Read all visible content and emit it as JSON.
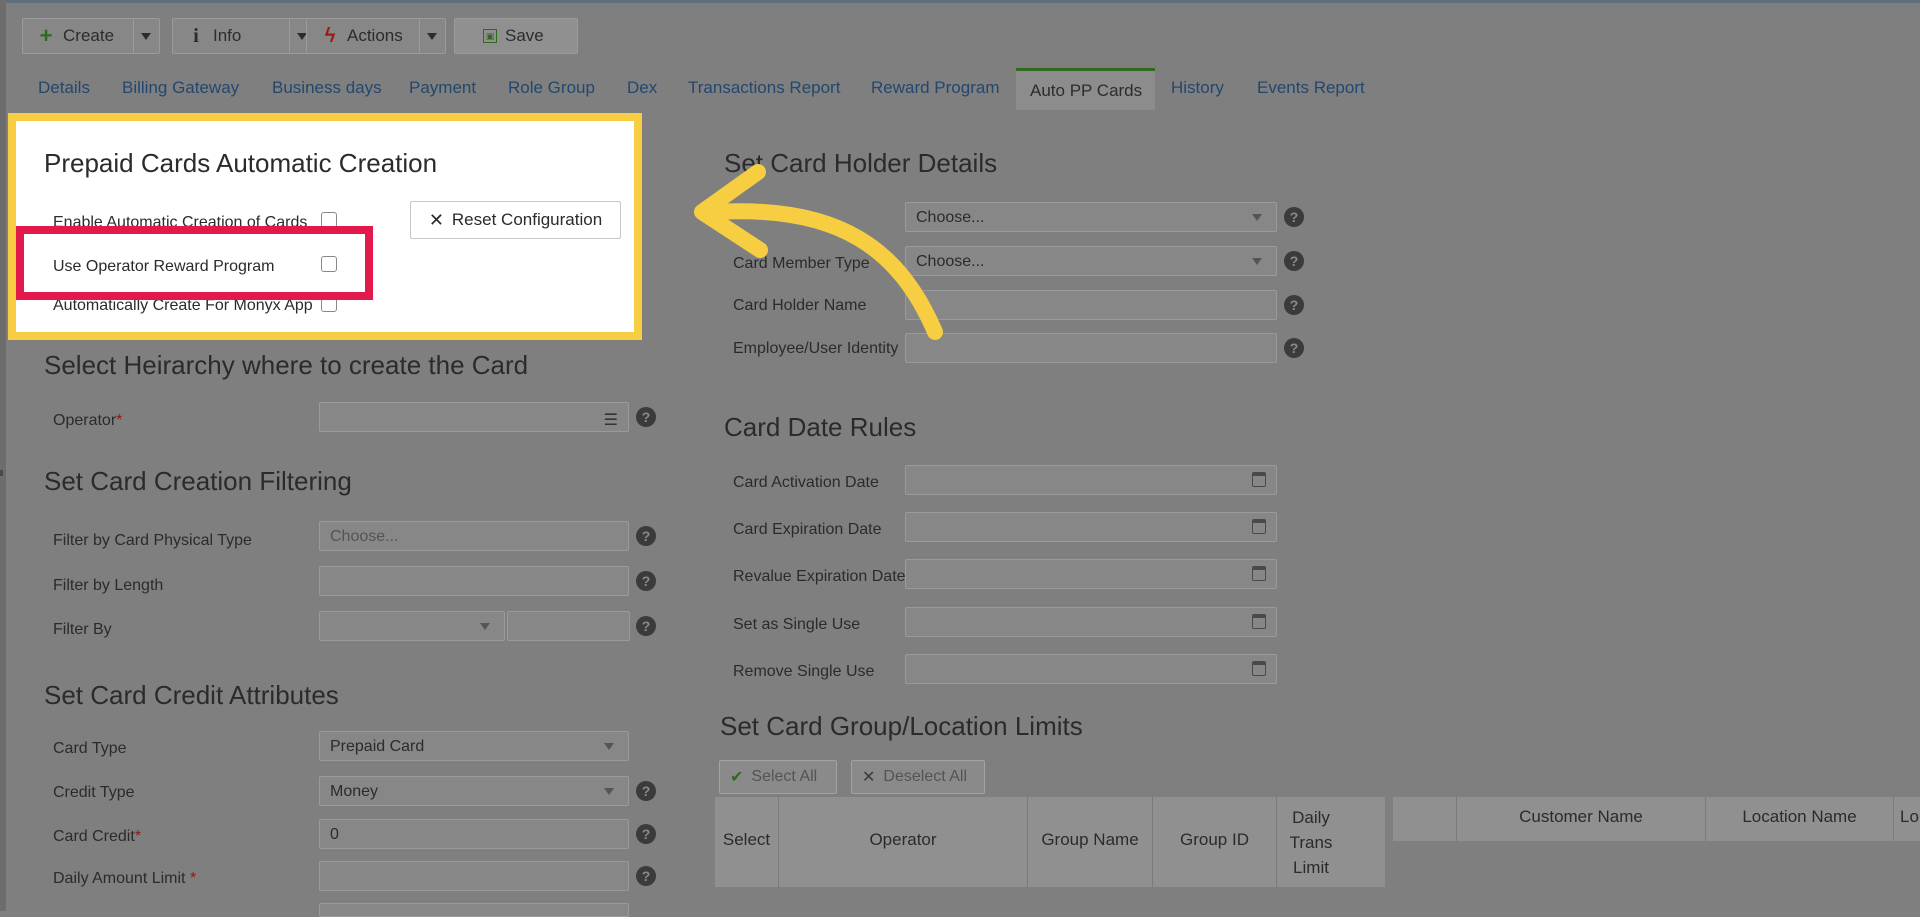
{
  "toolbar": {
    "create": "Create",
    "info": "Info",
    "actions": "Actions",
    "save": "Save"
  },
  "tabs": [
    "Details",
    "Billing Gateway",
    "Business days",
    "Payment",
    "Role Group",
    "Dex",
    "Transactions Report",
    "Reward Program",
    "Auto PP Cards",
    "History",
    "Events Report"
  ],
  "active_tab": "Auto PP Cards",
  "auto_creation": {
    "title": "Prepaid Cards Automatic Creation",
    "enable_label": "Enable Automatic Creation of Cards",
    "use_reward_label": "Use Operator Reward Program",
    "auto_monyx_label": "Automatically Create For Monyx App",
    "reset_label": "Reset Configuration"
  },
  "hierarchy": {
    "title": "Select Heirarchy where to create the Card",
    "operator_label": "Operator",
    "required_mark": "*"
  },
  "filtering": {
    "title": "Set Card Creation Filtering",
    "physical_type_label": "Filter by Card Physical Type",
    "physical_type_placeholder": "Choose...",
    "length_label": "Filter by Length",
    "filter_by_label": "Filter By"
  },
  "credit": {
    "title": "Set Card Credit Attributes",
    "card_type_label": "Card Type",
    "card_type_value": "Prepaid Card",
    "credit_type_label": "Credit Type",
    "credit_type_value": "Money",
    "card_credit_label": "Card Credit",
    "card_credit_value": "0",
    "daily_amount_label": "Daily Amount Limit ",
    "required_mark": "*"
  },
  "holder": {
    "title": "Set Card Holder Details",
    "row1_value": "Choose...",
    "member_type_label": "Card Member Type",
    "member_type_value": "Choose...",
    "holder_name_label": "Card Holder Name",
    "identity_label": "Employee/User Identity"
  },
  "dates": {
    "title": "Card Date Rules",
    "activation": "Card Activation Date",
    "expiration": "Card Expiration Date",
    "revalue": "Revalue Expiration Date",
    "single_use": "Set as Single Use",
    "remove_single": "Remove Single Use"
  },
  "limits": {
    "title": "Set Card Group/Location Limits",
    "select_all": "Select All",
    "deselect_all": "Deselect All",
    "columns_left": [
      "Select",
      "Operator",
      "Group Name",
      "Group ID",
      "Daily Trans Limit"
    ],
    "columns_right": [
      "Customer Name",
      "Location Name",
      "Lo"
    ]
  },
  "colors": {
    "highlight_frame": "#f7ce42",
    "focus_frame": "#e4194b",
    "arrow": "#f7ce42"
  }
}
